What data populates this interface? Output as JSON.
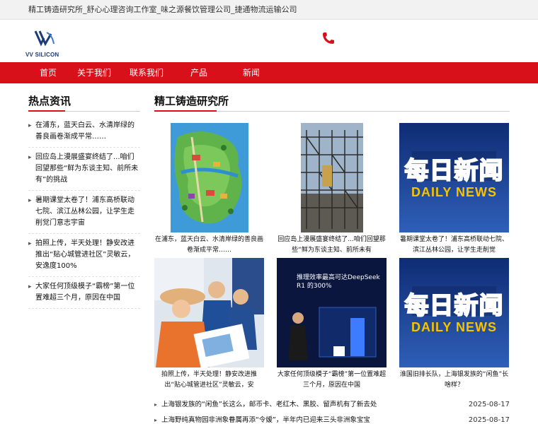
{
  "topbar": {
    "text": "精工铸造研究所_舒心心理咨询工作室_味之源餐饮管理公司_捷通物流运输公司"
  },
  "header": {
    "logo_text": "VV SILICON"
  },
  "nav": {
    "items": [
      "首页",
      "关于我们",
      "联系我们",
      "产品",
      "新闻"
    ]
  },
  "sidebar": {
    "title": "热点资讯",
    "items": [
      "在浦东，蓝天白云、水清岸绿的善良画卷渐成平常……",
      "回应岛上漫展盛宴终结了...咱们回望那些“鲜为东谈主知、前所未有”的挑战",
      "暑期课堂太卷了！浦东高桥联动七院、滨江丛林公园，让学生走削觉门意志宇宙",
      "拍照上传，半天处理！静安改进推出“贴心城管进社区”灵敏云，安逸度100%",
      "大家任何顶级模子“霸榜”第一位置难超三个月，原因在中国"
    ]
  },
  "main": {
    "title": "精工铸造研究所",
    "cards": [
      {
        "caption": "在浦东，蓝天白云、水清岸绿的善良画卷渐成平常……",
        "image": "map-illustration"
      },
      {
        "caption": "回应岛上漫展盛宴终结了...咱们回望那些“鲜为东谈主知、前所未有",
        "image": "scaffold-photo"
      },
      {
        "caption": "暑期课堂太卷了！浦东高桥联动七院、滨江丛林公园，让学生走削觉",
        "image": "daily-news-logo",
        "logo_cn": "每日新闻",
        "logo_en": "DAILY NEWS"
      },
      {
        "caption": "拍照上传，半天处理！静安改进推出“贴心城管进社区”灵敏云，安",
        "image": "community-photo"
      },
      {
        "caption": "大家任何顶级模子“霸榜”第一位置难超三个月，原因在中国",
        "image": "presentation-photo",
        "slide_title": "推理效率最高可达DeepSeek R1 的300%"
      },
      {
        "caption": "淮国旧排长队，上海银发族的“闲鱼”长啥样？",
        "image": "daily-news-logo",
        "logo_cn": "每日新闻",
        "logo_en": "DAILY NEWS"
      }
    ],
    "news": [
      {
        "title": "上海银发族的“闲鱼”长这么，邮币卡、老红木、黑胶、留声机有了新去处",
        "date": "2025-08-17"
      },
      {
        "title": "上海野纯真物园非洲象眷属再添“令嫒”，半年内已迎来三头非洲象宝宝",
        "date": "2025-08-17"
      }
    ]
  },
  "colors": {
    "nav_red": "#d8101a",
    "news_blue": "#1a3c8a"
  }
}
